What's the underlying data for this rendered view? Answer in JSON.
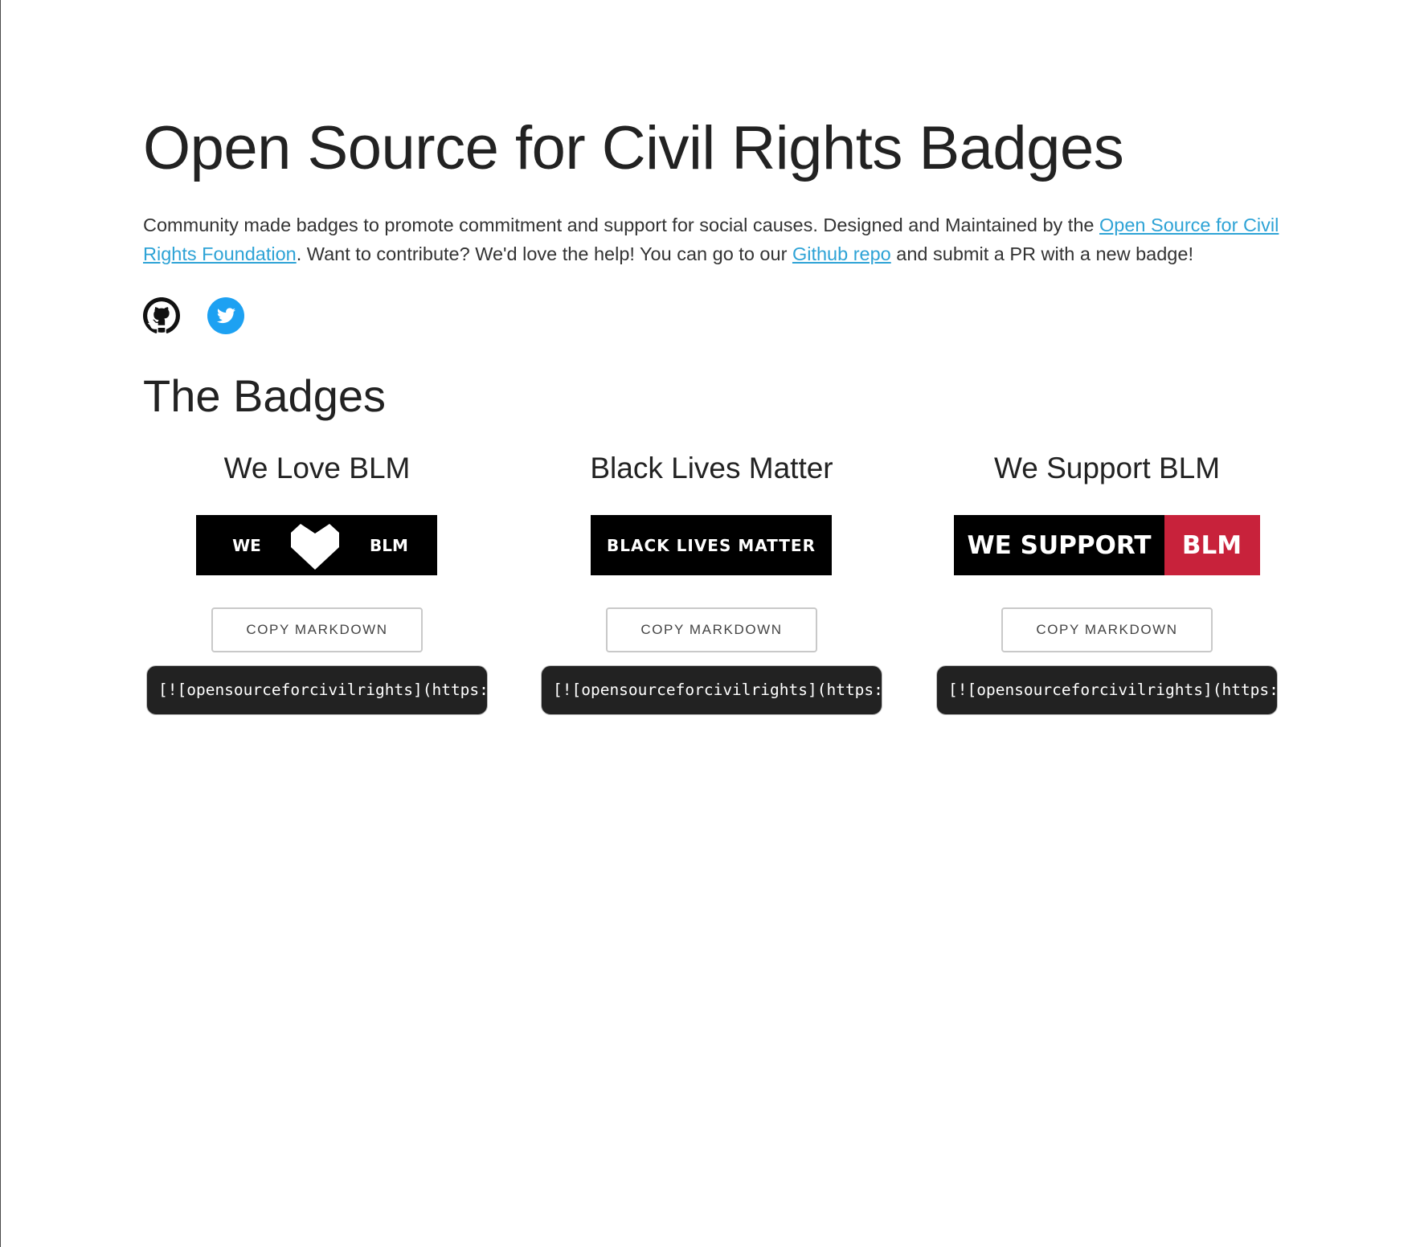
{
  "header": {
    "title": "Open Source for Civil Rights Badges"
  },
  "intro": {
    "text_before_link1": "Community made badges to promote commitment and support for social causes. Designed and Maintained by the ",
    "link1": "Open Source for Civil Rights Foundation",
    "text_between_links": ". Want to contribute? We'd love the help! You can go to our ",
    "link2": "Github repo",
    "text_after_link2": " and submit a PR with a new badge!"
  },
  "social": {
    "icons": [
      "github-icon",
      "twitter-icon"
    ],
    "twitter_color": "#1da1f2"
  },
  "section": {
    "title": "The Badges"
  },
  "badges": [
    {
      "name": "We Love BLM",
      "image_text_left": "WE",
      "image_text_right": "BLM",
      "copy_label": "COPY MARKDOWN",
      "markdown": "[![opensourceforcivilrights](https://"
    },
    {
      "name": "Black Lives Matter",
      "image_text": "BLACK LIVES MATTER",
      "copy_label": "COPY MARKDOWN",
      "markdown": "[![opensourceforcivilrights](https://"
    },
    {
      "name": "We Support BLM",
      "image_text_left": "WE SUPPORT",
      "image_text_right": "BLM",
      "copy_label": "COPY MARKDOWN",
      "markdown": "[![opensourceforcivilrights](https://"
    }
  ],
  "colors": {
    "link": "#2ea3d6",
    "badge_black": "#000000",
    "badge_red": "#c8223b",
    "code_bg": "#222222"
  }
}
